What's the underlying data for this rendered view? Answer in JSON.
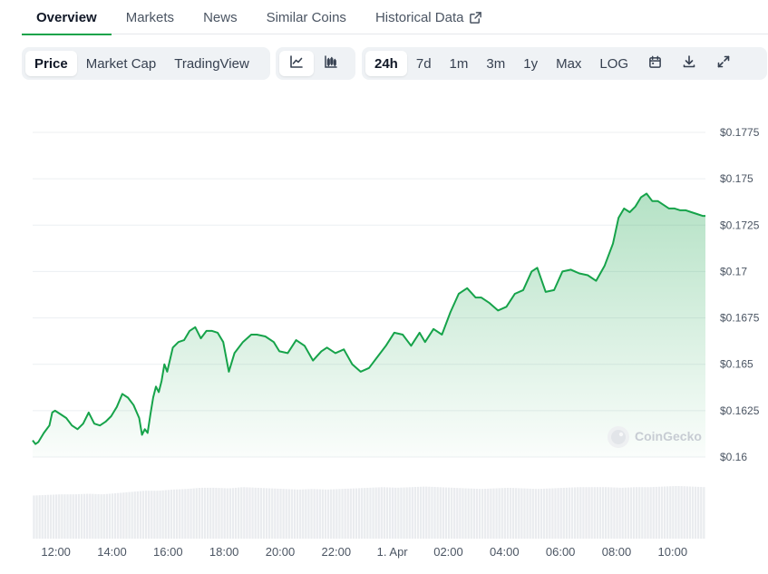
{
  "tabs": [
    {
      "label": "Overview",
      "active": true
    },
    {
      "label": "Markets",
      "active": false
    },
    {
      "label": "News",
      "active": false
    },
    {
      "label": "Similar Coins",
      "active": false
    },
    {
      "label": "Historical Data",
      "active": false,
      "icon": "external-link-icon"
    }
  ],
  "toolbar": {
    "metric_tabs": [
      {
        "label": "Price",
        "active": true
      },
      {
        "label": "Market Cap",
        "active": false
      },
      {
        "label": "TradingView",
        "active": false
      }
    ],
    "chart_type_icons": [
      {
        "icon": "line-chart-icon",
        "active": true
      },
      {
        "icon": "candlestick-chart-icon",
        "active": false
      }
    ],
    "ranges": [
      {
        "label": "24h",
        "active": true
      },
      {
        "label": "7d",
        "active": false
      },
      {
        "label": "1m",
        "active": false
      },
      {
        "label": "3m",
        "active": false
      },
      {
        "label": "1y",
        "active": false
      },
      {
        "label": "Max",
        "active": false
      },
      {
        "label": "LOG",
        "active": false
      }
    ],
    "action_icons": [
      "calendar-icon",
      "download-icon",
      "fullscreen-icon"
    ]
  },
  "watermark": "CoinGecko",
  "colors": {
    "line": "#16a34a",
    "grid": "#eceff2",
    "volume": "#eaecef",
    "accent": "#16a34a"
  },
  "chart_data": {
    "type": "area",
    "y_tick_labels": [
      "$0.16",
      "$0.1625",
      "$0.165",
      "$0.1675",
      "$0.17",
      "$0.1725",
      "$0.175",
      "$0.1775"
    ],
    "y_ticks": [
      0.16,
      0.1625,
      0.165,
      0.1675,
      0.17,
      0.1725,
      0.175,
      0.1775
    ],
    "ylim": [
      0.16,
      0.1775
    ],
    "x_tick_labels": [
      "12:00",
      "14:00",
      "16:00",
      "18:00",
      "20:00",
      "22:00",
      "1. Apr",
      "02:00",
      "04:00",
      "06:00",
      "08:00",
      "10:00"
    ],
    "x_ticks": [
      0.83,
      2.83,
      4.83,
      6.83,
      8.83,
      10.83,
      12.83,
      14.83,
      16.83,
      18.83,
      20.83,
      22.83
    ],
    "xlim": [
      0,
      24
    ],
    "series": [
      {
        "x": [
          0,
          0.1,
          0.2,
          0.4,
          0.6,
          0.7,
          0.8,
          1,
          1.2,
          1.4,
          1.6,
          1.8,
          2,
          2.2,
          2.4,
          2.6,
          2.8,
          3,
          3.2,
          3.4,
          3.6,
          3.8,
          3.9,
          4,
          4.1,
          4.2,
          4.3,
          4.4,
          4.5,
          4.6,
          4.7,
          4.8,
          5,
          5.2,
          5.4,
          5.6,
          5.8,
          6,
          6.2,
          6.4,
          6.6,
          6.8,
          7.0,
          7.2,
          7.5,
          7.8,
          8,
          8.3,
          8.6,
          8.8,
          9.1,
          9.4,
          9.7,
          10,
          10.3,
          10.5,
          10.8,
          11.1,
          11.4,
          11.7,
          12,
          12.3,
          12.6,
          12.9,
          13.2,
          13.5,
          13.8,
          14,
          14.3,
          14.6,
          14.9,
          15.2,
          15.5,
          15.8,
          16,
          16.3,
          16.6,
          16.9,
          17.2,
          17.5,
          17.8,
          18,
          18.3,
          18.6,
          18.9,
          19.2,
          19.5,
          19.8,
          20.1,
          20.4,
          20.7,
          20.9,
          21.1,
          21.3,
          21.5,
          21.7,
          21.9,
          22.1,
          22.3,
          22.5,
          22.7,
          22.9,
          23.1,
          23.3,
          23.5,
          23.7,
          23.9,
          24
        ],
        "values": [
          0.1609,
          0.1607,
          0.1608,
          0.1613,
          0.1617,
          0.1624,
          0.1625,
          0.1623,
          0.1621,
          0.1617,
          0.1615,
          0.1618,
          0.1624,
          0.1618,
          0.1617,
          0.1619,
          0.1622,
          0.1627,
          0.1634,
          0.1632,
          0.1628,
          0.1621,
          0.1612,
          0.1615,
          0.1613,
          0.1623,
          0.1632,
          0.1638,
          0.1635,
          0.1641,
          0.165,
          0.1646,
          0.1659,
          0.1662,
          0.1663,
          0.1668,
          0.167,
          0.1664,
          0.1668,
          0.1668,
          0.1667,
          0.1662,
          0.1646,
          0.1656,
          0.1662,
          0.1666,
          0.1666,
          0.1665,
          0.1662,
          0.1657,
          0.1656,
          0.1663,
          0.166,
          0.1652,
          0.1657,
          0.1659,
          0.1656,
          0.1658,
          0.165,
          0.1646,
          0.1648,
          0.1654,
          0.166,
          0.1667,
          0.1666,
          0.166,
          0.1667,
          0.1662,
          0.1669,
          0.1666,
          0.1678,
          0.1688,
          0.1691,
          0.1686,
          0.1686,
          0.1683,
          0.1679,
          0.1681,
          0.1688,
          0.169,
          0.17,
          0.1702,
          0.1689,
          0.169,
          0.17,
          0.1701,
          0.1699,
          0.1698,
          0.1695,
          0.1703,
          0.1715,
          0.1729,
          0.1734,
          0.1732,
          0.1735,
          0.174,
          0.1742,
          0.1738,
          0.1738,
          0.1736,
          0.1734,
          0.1734,
          0.1733,
          0.1733,
          0.1732,
          0.1731,
          0.173,
          0.173
        ]
      }
    ],
    "volume": {
      "x": [
        0,
        0.5,
        1,
        1.5,
        2,
        2.5,
        3,
        3.5,
        4,
        4.5,
        5,
        5.5,
        6,
        6.5,
        7,
        7.5,
        8,
        8.5,
        9,
        9.5,
        10,
        10.5,
        11,
        11.5,
        12,
        12.5,
        13,
        13.5,
        14,
        14.5,
        15,
        15.5,
        16,
        16.5,
        17,
        17.5,
        18,
        18.5,
        19,
        19.5,
        20,
        20.5,
        21,
        21.5,
        22,
        22.5,
        23,
        23.5,
        24
      ],
      "relative": [
        0.72,
        0.73,
        0.74,
        0.74,
        0.75,
        0.74,
        0.76,
        0.78,
        0.8,
        0.8,
        0.82,
        0.83,
        0.85,
        0.85,
        0.84,
        0.86,
        0.85,
        0.84,
        0.83,
        0.82,
        0.83,
        0.82,
        0.83,
        0.84,
        0.85,
        0.86,
        0.85,
        0.86,
        0.87,
        0.86,
        0.85,
        0.84,
        0.83,
        0.84,
        0.85,
        0.84,
        0.83,
        0.84,
        0.85,
        0.86,
        0.86,
        0.86,
        0.85,
        0.86,
        0.86,
        0.87,
        0.88,
        0.87,
        0.86
      ]
    }
  }
}
